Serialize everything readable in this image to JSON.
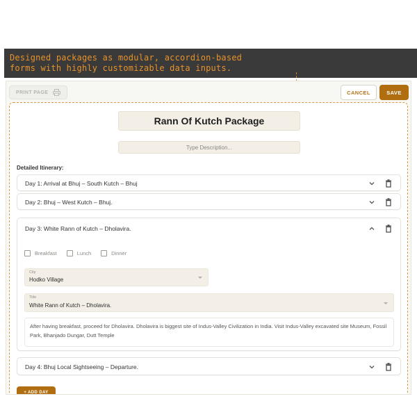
{
  "annotation": {
    "line1": "Designed packages as modular, accordion-based",
    "line2": "forms with highly customizable data inputs."
  },
  "toolbar": {
    "print_label": "PRINT PAGE",
    "cancel_label": "CANCEL",
    "save_label": "SAVE"
  },
  "package": {
    "title": "Rann Of Kutch Package",
    "description_placeholder": "Type Description...",
    "itinerary_label": "Detailed Itinerary:"
  },
  "days": [
    {
      "label": "Day 1: Arrival at Bhuj – South Kutch – Bhuj",
      "expanded": false
    },
    {
      "label": "Day 2: Bhuj – West Kutch – Bhuj.",
      "expanded": false
    },
    {
      "label": "Day 3: White Rann of Kutch – Dholavira.",
      "expanded": true,
      "meals": [
        "Breakfast",
        "Lunch",
        "Dinner"
      ],
      "city_label": "City",
      "city_value": "Hodko Village",
      "title_label": "Title",
      "title_value": "White Rann of Kutch – Dholavira.",
      "details": "After having breakfast, proceed for Dholavira. Dholavira is biggest site of Indus-Valley Civilization in India. Visit Indus-Valley excavated site Museum, Fossil Park, Bhanjado Dungar, Dutt Temple"
    },
    {
      "label": "Day 4: Bhuj Local Sightseeing – Departure.",
      "expanded": false
    }
  ],
  "add_day_label": "+ ADD DAY",
  "colors": {
    "accent": "#b06e10",
    "annotation_text": "#e8922b",
    "annotation_bg": "#3a3a3a",
    "field_bg": "#f3efe6"
  },
  "icons": {
    "print": "printer-icon",
    "expand": "chevron-down-icon",
    "collapse": "chevron-up-icon",
    "delete": "trash-icon"
  }
}
